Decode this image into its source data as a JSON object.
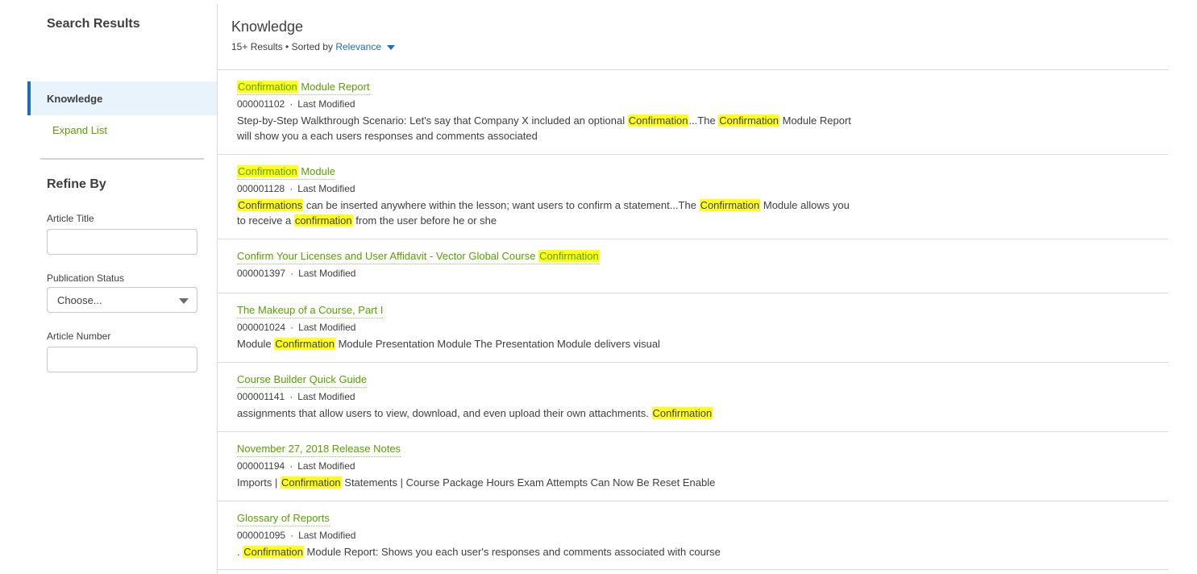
{
  "sidebar": {
    "title": "Search Results",
    "nav_item": "Knowledge",
    "expand_list": "Expand List",
    "refine_title": "Refine By",
    "article_title_label": "Article Title",
    "publication_status_label": "Publication Status",
    "publication_status_value": "Choose...",
    "article_number_label": "Article Number"
  },
  "main": {
    "title": "Knowledge",
    "result_count": "15+ Results",
    "separator": "•",
    "sorted_by": "Sorted by",
    "sort_value": "Relevance"
  },
  "meta_separator": "·",
  "results": [
    {
      "title": [
        {
          "t": "Confirmation",
          "h": true
        },
        {
          "t": " Module Report",
          "h": false
        }
      ],
      "number": "000001102",
      "modified": "Last Modified",
      "snippet": [
        {
          "t": "Step-by-Step Walkthrough Scenario: Let's say that Company X included an optional ",
          "h": false
        },
        {
          "t": "Confirmation",
          "h": true
        },
        {
          "t": "...The ",
          "h": false
        },
        {
          "t": "Confirmation",
          "h": true
        },
        {
          "t": " Module Report will show you a each users responses and comments associated",
          "h": false
        }
      ]
    },
    {
      "title": [
        {
          "t": "Confirmation",
          "h": true
        },
        {
          "t": " Module",
          "h": false
        }
      ],
      "number": "000001128",
      "modified": "Last Modified",
      "snippet": [
        {
          "t": "Confirmations",
          "h": true
        },
        {
          "t": " can be inserted anywhere within the lesson; want users to confirm a statement...The ",
          "h": false
        },
        {
          "t": "Confirmation",
          "h": true
        },
        {
          "t": " Module allows you to receive a ",
          "h": false
        },
        {
          "t": "confirmation",
          "h": true
        },
        {
          "t": " from the user before he or she",
          "h": false
        }
      ]
    },
    {
      "title": [
        {
          "t": "Confirm Your Licenses and User Affidavit - Vector Global Course ",
          "h": false
        },
        {
          "t": "Confirmation",
          "h": true
        }
      ],
      "number": "000001397",
      "modified": "Last Modified",
      "snippet": []
    },
    {
      "title": [
        {
          "t": "The Makeup of a Course, Part I",
          "h": false
        }
      ],
      "number": "000001024",
      "modified": "Last Modified",
      "snippet": [
        {
          "t": "Module ",
          "h": false
        },
        {
          "t": "Confirmation",
          "h": true
        },
        {
          "t": " Module Presentation Module The Presentation Module delivers visual",
          "h": false
        }
      ]
    },
    {
      "title": [
        {
          "t": "Course Builder Quick Guide",
          "h": false
        }
      ],
      "number": "000001141",
      "modified": "Last Modified",
      "snippet": [
        {
          "t": "assignments that allow users to view, download, and even upload their own attachments. ",
          "h": false
        },
        {
          "t": "Confirmation",
          "h": true
        }
      ]
    },
    {
      "title": [
        {
          "t": "November 27, 2018 Release Notes",
          "h": false
        }
      ],
      "number": "000001194",
      "modified": "Last Modified",
      "snippet": [
        {
          "t": "Imports | ",
          "h": false
        },
        {
          "t": "Confirmation",
          "h": true
        },
        {
          "t": " Statements | Course Package Hours Exam Attempts Can Now Be Reset Enable",
          "h": false
        }
      ]
    },
    {
      "title": [
        {
          "t": "Glossary of Reports",
          "h": false
        }
      ],
      "number": "000001095",
      "modified": "Last Modified",
      "snippet": [
        {
          "t": ". ",
          "h": false
        },
        {
          "t": "Confirmation",
          "h": true
        },
        {
          "t": " Module Report: Shows you each user's responses and comments associated with course",
          "h": false
        }
      ]
    }
  ],
  "colors": {
    "link_green": "#57a100",
    "sort_blue": "#1b6fba",
    "highlight": "#ffff1a",
    "nav_active_bg": "#e8f3fc"
  }
}
